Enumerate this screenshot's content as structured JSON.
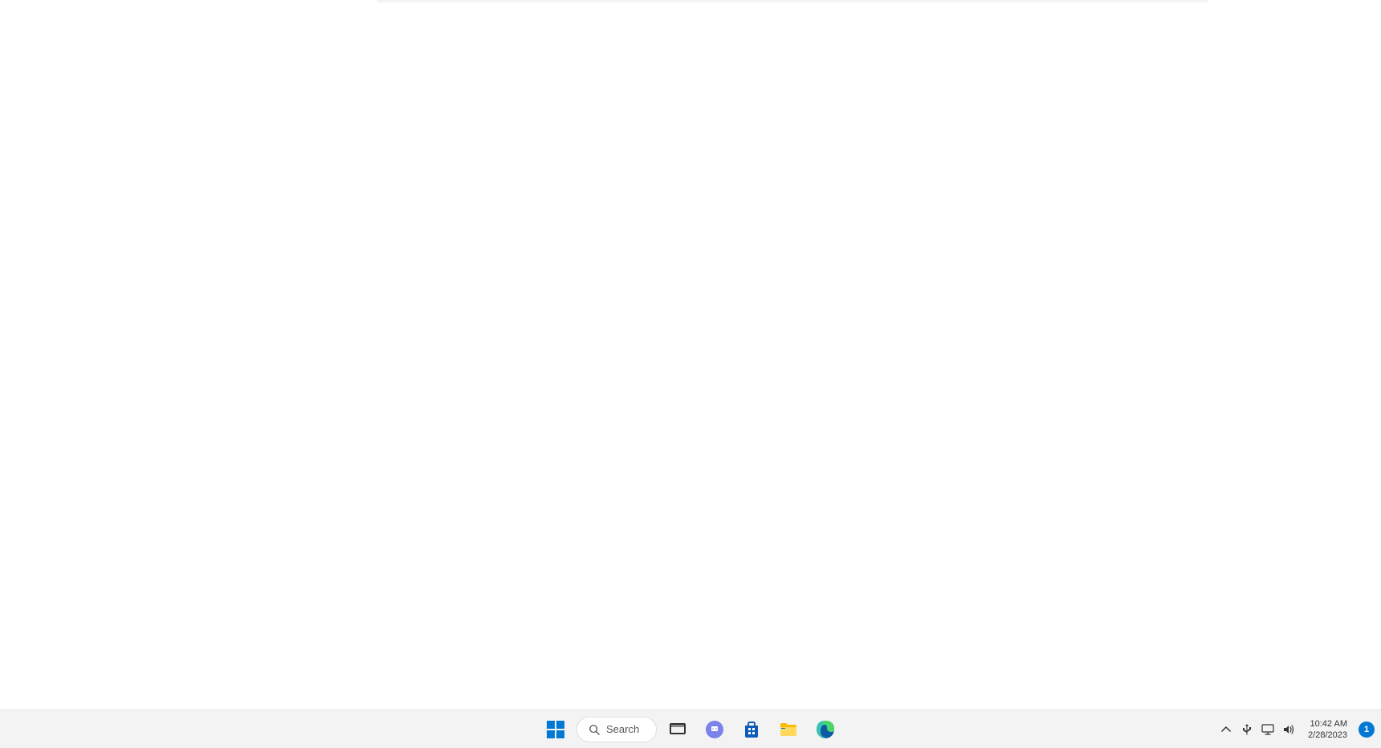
{
  "taskbar": {
    "search_label": "Search",
    "apps": [
      {
        "name": "start",
        "label": "Start"
      },
      {
        "name": "task-view",
        "label": "Task View"
      },
      {
        "name": "chat",
        "label": "Chat"
      },
      {
        "name": "microsoft-store",
        "label": "Microsoft Store"
      },
      {
        "name": "file-explorer",
        "label": "File Explorer"
      },
      {
        "name": "edge",
        "label": "Microsoft Edge"
      }
    ]
  },
  "systray": {
    "clock_time": "10:42 AM",
    "clock_date": "2/28/2023",
    "notification_count": "1",
    "icons": [
      {
        "name": "show-hidden-icons"
      },
      {
        "name": "usb-device"
      },
      {
        "name": "display-settings"
      },
      {
        "name": "volume"
      }
    ]
  }
}
